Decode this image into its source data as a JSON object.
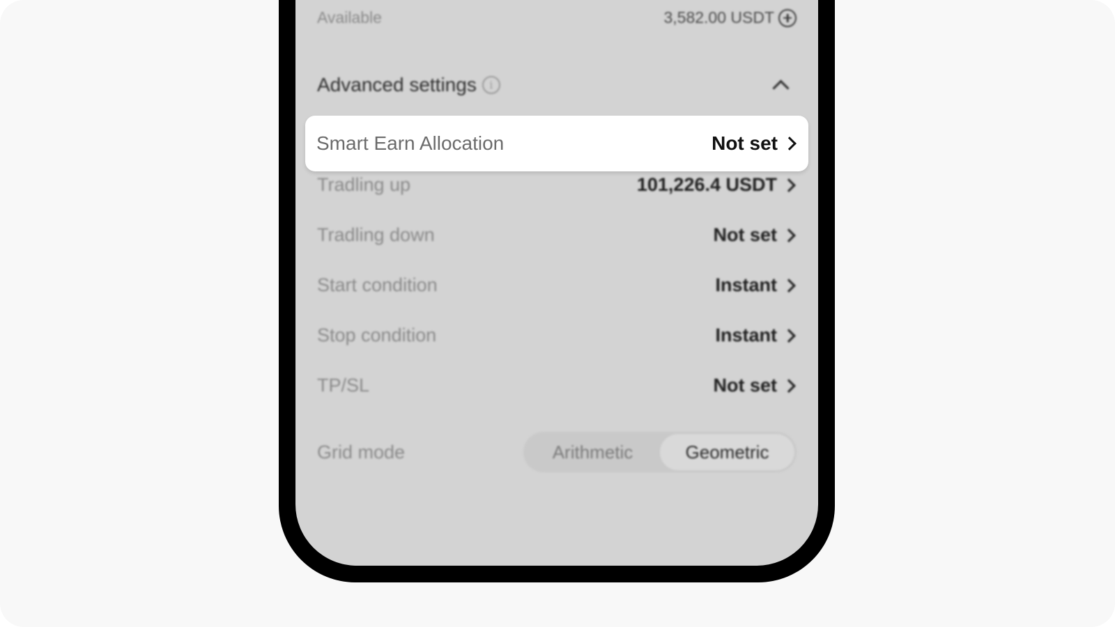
{
  "available": {
    "label": "Available",
    "value": "3,582.00 USDT"
  },
  "advanced": {
    "title": "Advanced settings"
  },
  "highlight": {
    "label": "Smart Earn Allocation",
    "value": "Not set"
  },
  "settings": [
    {
      "label": "Tradling up",
      "value": "101,226.4 USDT"
    },
    {
      "label": "Tradling down",
      "value": "Not set"
    },
    {
      "label": "Start condition",
      "value": "Instant"
    },
    {
      "label": "Stop condition",
      "value": "Instant"
    },
    {
      "label": "TP/SL",
      "value": "Not set"
    }
  ],
  "grid_mode": {
    "label": "Grid mode",
    "options": [
      "Arithmetic",
      "Geometric"
    ],
    "selected": "Geometric"
  },
  "colors": {
    "screen_bg": "#d3d3d3",
    "phone_frame": "#000000",
    "page_bg": "#f8f8f8",
    "highlight_bg": "#ffffff"
  },
  "icons": {
    "available_action": "plus-circle-icon",
    "advanced_info": "info-icon",
    "collapse": "chevron-up-icon",
    "row_arrow": "chevron-right-icon"
  }
}
